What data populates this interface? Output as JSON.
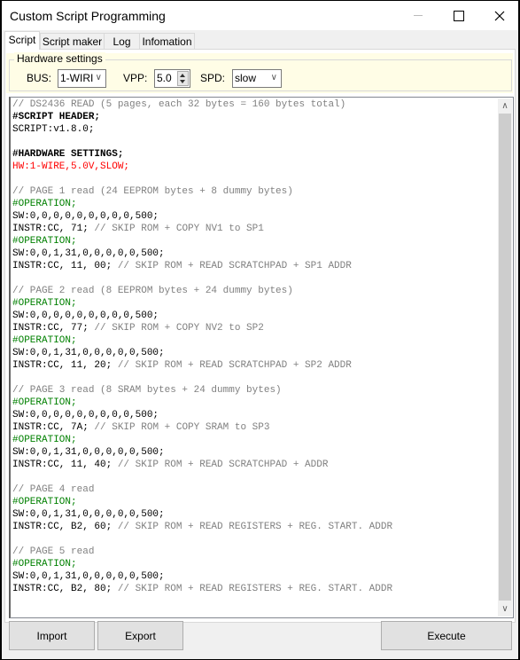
{
  "window": {
    "title": "Custom Script Programming",
    "controls": {
      "minimize": "minimize-icon",
      "maximize": "maximize-icon",
      "close": "close-icon"
    }
  },
  "tabs": [
    {
      "label": "Script",
      "active": true
    },
    {
      "label": "Script maker",
      "active": false
    },
    {
      "label": "Log",
      "active": false
    },
    {
      "label": "Infomation",
      "active": false
    }
  ],
  "hardware": {
    "legend": "Hardware settings",
    "bus_label": "BUS:",
    "bus_value": "1-WIRI",
    "vpp_label": "VPP:",
    "vpp_value": "5.0",
    "spd_label": "SPD:",
    "spd_value": "slow"
  },
  "script_lines": [
    {
      "text": "// DS2436 READ (5 pages, each 32 bytes = 160 bytes total)",
      "kind": "comment"
    },
    {
      "text": "#SCRIPT HEADER;",
      "kind": "directive"
    },
    {
      "text": "SCRIPT:v1.8.0;",
      "kind": "cmd"
    },
    {
      "text": "",
      "kind": "cmd"
    },
    {
      "text": "#HARDWARE SETTINGS;",
      "kind": "directive"
    },
    {
      "text": "HW:1-WIRE,5.0V,SLOW;",
      "kind": "hw"
    },
    {
      "text": "",
      "kind": "cmd"
    },
    {
      "text": "// PAGE 1 read (24 EEPROM bytes + 8 dummy bytes)",
      "kind": "comment"
    },
    {
      "text": "#OPERATION;",
      "kind": "op"
    },
    {
      "text": "SW:0,0,0,0,0,0,0,0,0,500;",
      "kind": "cmd"
    },
    {
      "text": "INSTR:CC, 71;",
      "comment": " // SKIP ROM + COPY NV1 to SP1",
      "kind": "cmd"
    },
    {
      "text": "#OPERATION;",
      "kind": "op"
    },
    {
      "text": "SW:0,0,1,31,0,0,0,0,0,500;",
      "kind": "cmd"
    },
    {
      "text": "INSTR:CC, 11, 00;",
      "comment": " // SKIP ROM + READ SCRATCHPAD + SP1 ADDR",
      "kind": "cmd"
    },
    {
      "text": "",
      "kind": "cmd"
    },
    {
      "text": "// PAGE 2 read (8 EEPROM bytes + 24 dummy bytes)",
      "kind": "comment"
    },
    {
      "text": "#OPERATION;",
      "kind": "op"
    },
    {
      "text": "SW:0,0,0,0,0,0,0,0,0,500;",
      "kind": "cmd"
    },
    {
      "text": "INSTR:CC, 77;",
      "comment": " // SKIP ROM + COPY NV2 to SP2",
      "kind": "cmd"
    },
    {
      "text": "#OPERATION;",
      "kind": "op"
    },
    {
      "text": "SW:0,0,1,31,0,0,0,0,0,500;",
      "kind": "cmd"
    },
    {
      "text": "INSTR:CC, 11, 20;",
      "comment": " // SKIP ROM + READ SCRATCHPAD + SP2 ADDR",
      "kind": "cmd"
    },
    {
      "text": "",
      "kind": "cmd"
    },
    {
      "text": "// PAGE 3 read (8 SRAM bytes + 24 dummy bytes)",
      "kind": "comment"
    },
    {
      "text": "#OPERATION;",
      "kind": "op"
    },
    {
      "text": "SW:0,0,0,0,0,0,0,0,0,500;",
      "kind": "cmd"
    },
    {
      "text": "INSTR:CC, 7A;",
      "comment": " // SKIP ROM + COPY SRAM to SP3",
      "kind": "cmd"
    },
    {
      "text": "#OPERATION;",
      "kind": "op"
    },
    {
      "text": "SW:0,0,1,31,0,0,0,0,0,500;",
      "kind": "cmd"
    },
    {
      "text": "INSTR:CC, 11, 40;",
      "comment": " // SKIP ROM + READ SCRATCHPAD + ADDR",
      "kind": "cmd"
    },
    {
      "text": "",
      "kind": "cmd"
    },
    {
      "text": "// PAGE 4 read",
      "kind": "comment"
    },
    {
      "text": "#OPERATION;",
      "kind": "op"
    },
    {
      "text": "SW:0,0,1,31,0,0,0,0,0,500;",
      "kind": "cmd"
    },
    {
      "text": "INSTR:CC, B2, 60;",
      "comment": " // SKIP ROM + READ REGISTERS + REG. START. ADDR",
      "kind": "cmd"
    },
    {
      "text": "",
      "kind": "cmd"
    },
    {
      "text": "// PAGE 5 read",
      "kind": "comment"
    },
    {
      "text": "#OPERATION;",
      "kind": "op"
    },
    {
      "text": "SW:0,0,1,31,0,0,0,0,0,500;",
      "kind": "cmd"
    },
    {
      "text": "INSTR:CC, B2, 80;",
      "comment": " // SKIP ROM + READ REGISTERS + REG. START. ADDR",
      "kind": "cmd"
    }
  ],
  "buttons": {
    "import": "Import",
    "export": "Export",
    "execute": "Execute"
  },
  "colors": {
    "comment": "#808080",
    "operation": "#008000",
    "hardware": "#ff0000",
    "panel_bg": "#fffde6"
  }
}
